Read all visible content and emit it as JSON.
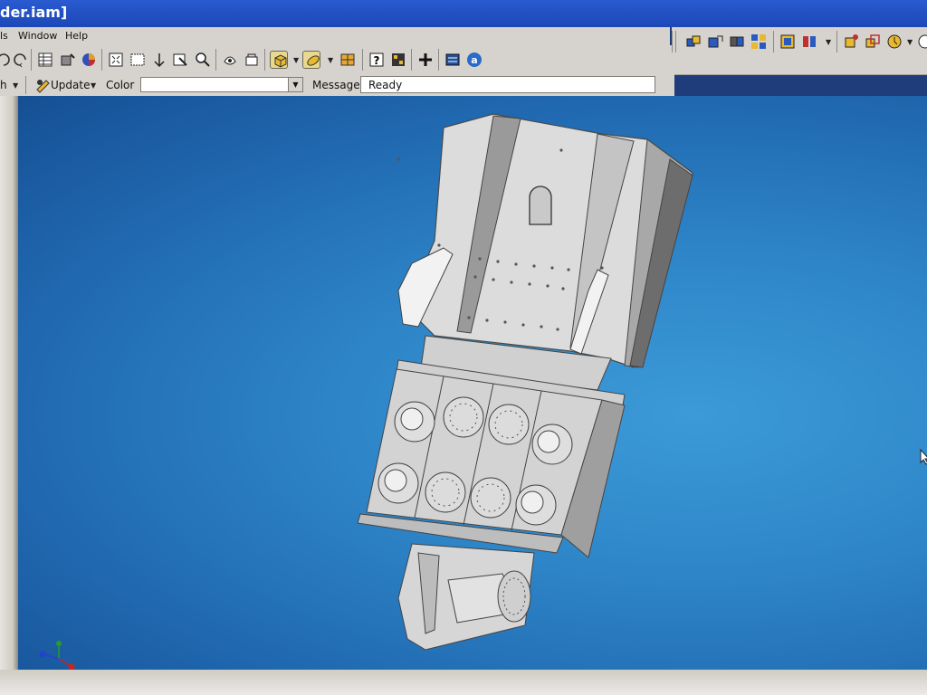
{
  "window": {
    "title": "der.iam]"
  },
  "menu": {
    "items": [
      "ls",
      "Window",
      "Help"
    ]
  },
  "toolbar": {
    "icons": [
      "undo-icon",
      "redo-icon",
      "parts-list-icon",
      "place-component-icon",
      "color-wheel-icon",
      "zoom-all-icon",
      "zoom-window-icon",
      "pan-icon",
      "zoom-icon",
      "look-at-icon",
      "rotate-icon",
      "orbit-icon",
      "display-style-icon",
      "view-cube-icon",
      "section-icon",
      "help-icon",
      "grid-icon",
      "add-icon",
      "bom-icon",
      "autodesk-online-icon"
    ]
  },
  "options": {
    "truncated_label": "h",
    "update_label": "Update",
    "color_label": "Color",
    "color_value": "",
    "message_label": "Message",
    "message_value": "Ready"
  },
  "colors": {
    "toolbar_bg": "#d6d3ce",
    "title_blue": "#1c47b8",
    "viewport_blue": "#2e86c8",
    "model_gray": "#d9d9d9"
  }
}
